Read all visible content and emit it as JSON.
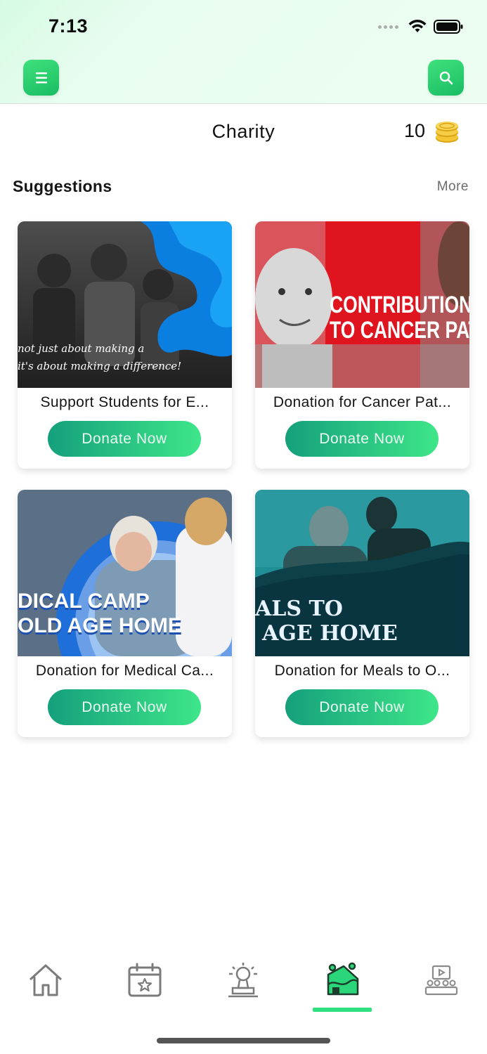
{
  "status_bar": {
    "time": "7:13"
  },
  "header": {
    "title": "Charity",
    "coin_count": "10"
  },
  "suggestions": {
    "title": "Suggestions",
    "more_label": "More"
  },
  "cards": [
    {
      "title": "Support Students for E...",
      "button_label": "Donate Now",
      "banner_line1": "not just about making a",
      "banner_line2": "it's about making a difference!"
    },
    {
      "title": "Donation for Cancer Pat...",
      "button_label": "Donate Now",
      "banner_line1": "CONTRIBUTION",
      "banner_line2": "TO CANCER PATIE"
    },
    {
      "title": "Donation for Medical Ca...",
      "button_label": "Donate Now",
      "banner_line1": "DICAL CAMP",
      "banner_line2": "OLD AGE HOME"
    },
    {
      "title": "Donation for Meals to O...",
      "button_label": "Donate Now",
      "banner_line1": "ALS TO",
      "banner_line2": "AGE HOME"
    }
  ],
  "bottom_nav": [
    {
      "icon": "home-icon",
      "active": false
    },
    {
      "icon": "calendar-star-icon",
      "active": false
    },
    {
      "icon": "trophy-icon",
      "active": false
    },
    {
      "icon": "charity-donation-icon",
      "active": true
    },
    {
      "icon": "video-audience-icon",
      "active": false
    }
  ],
  "colors": {
    "accent": "#2ee07f",
    "button_start": "#15a07c",
    "button_end": "#3ee689",
    "card_red": "#e0141e",
    "card_blue": "#1e6fd9",
    "card_teal": "#0e3b45"
  }
}
